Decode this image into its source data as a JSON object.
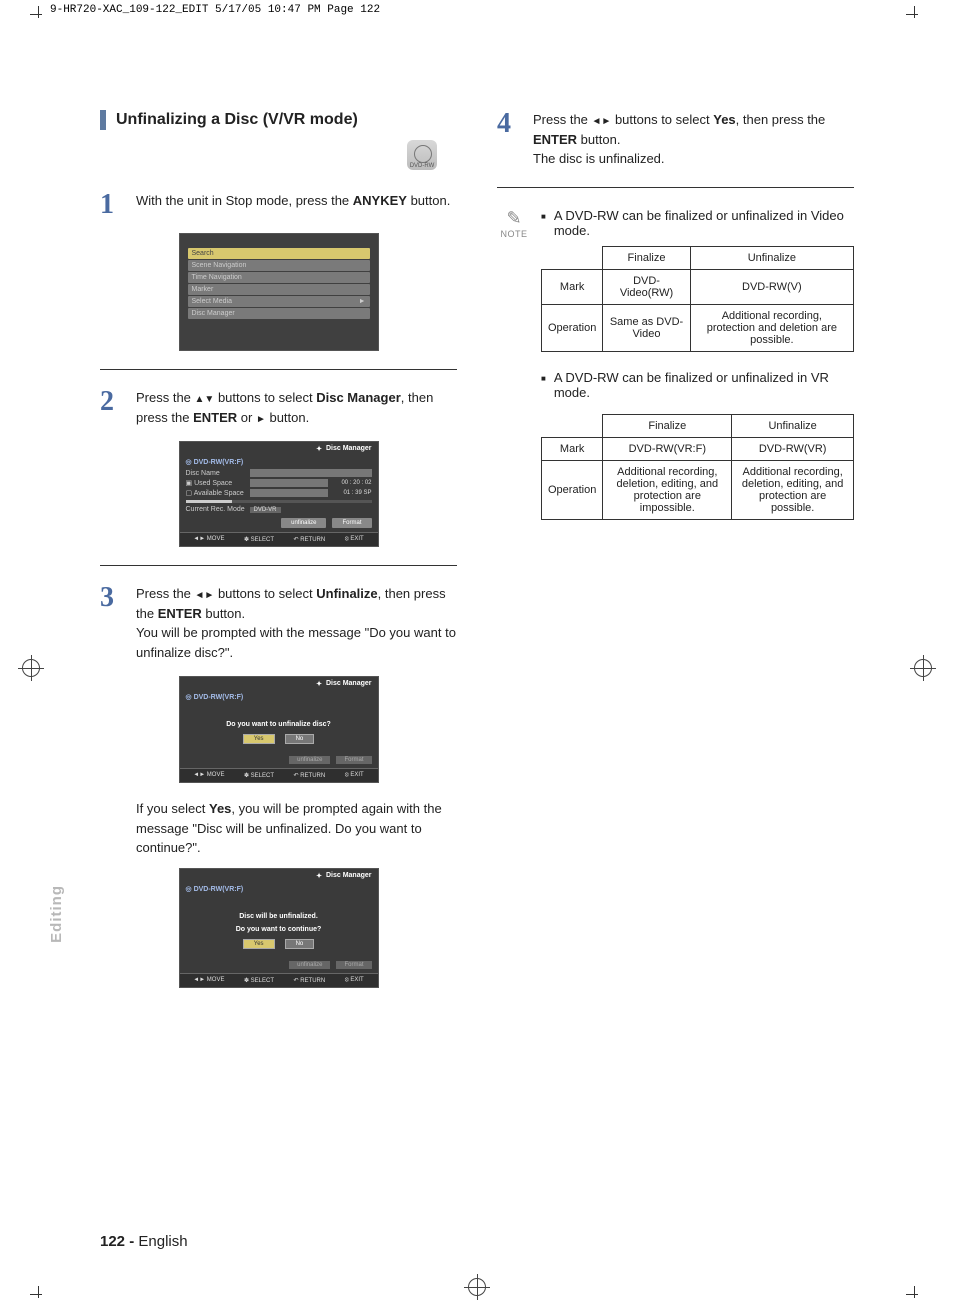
{
  "print_header": "9-HR720-XAC_109-122_EDIT  5/17/05  10:47 PM  Page 122",
  "side_tab": "Editing",
  "page_footer_num": "122 -",
  "page_footer_lang": "English",
  "section": {
    "title": "Unfinalizing a Disc (V/VR mode)",
    "disc_icon_label": "DVD-RW"
  },
  "steps": {
    "s1": {
      "num": "1",
      "text_pre": "With the unit in Stop mode, press the ",
      "bold1": "ANYKEY",
      "text_post": " button."
    },
    "s2": {
      "num": "2",
      "text_a": "Press the ",
      "text_b": " buttons to select ",
      "bold1": "Disc Manager",
      "text_c": ", then press the ",
      "bold2": "ENTER",
      "text_d": " or ",
      "text_e": " button."
    },
    "s3": {
      "num": "3",
      "text_a": "Press the ",
      "text_b": " buttons to select ",
      "bold1": "Unfinalize",
      "text_c": ", then press the ",
      "bold2": "ENTER",
      "text_d": " button.",
      "text_e": "You will be prompted with the message \"Do you want to unfinalize disc?\"."
    },
    "s3_follow": "If you select Yes, you will be prompted again with the message \"Disc will be unfinalized. Do you want to continue?\".",
    "s3_follow_bold": "Yes",
    "s4": {
      "num": "4",
      "text_a": "Press the ",
      "text_b": " buttons to select ",
      "bold1": "Yes",
      "text_c": ", then press the ",
      "bold2": "ENTER",
      "text_d": " button.",
      "text_e": "The disc is unfinalized."
    }
  },
  "osd": {
    "anykey": {
      "items": [
        "Search",
        "Scene Navigation",
        "Time Navigation",
        "Marker",
        "Select Media",
        "Disc Manager"
      ],
      "highlight_index": 0,
      "arrow_index": 4
    },
    "dm": {
      "title": "Disc Manager",
      "media": "DVD-RW(VR:F)",
      "rows": {
        "disc_name": "Disc Name",
        "used_space": "Used Space",
        "used_val": "00 : 20 : 02",
        "avail_space": "Available Space",
        "avail_val": "01 : 39 SP",
        "rec_mode": "Current Rec. Mode",
        "rec_val": "DVD-VR"
      },
      "btns": {
        "unfinalize": "unfinalize",
        "format": "Format"
      },
      "help": {
        "move": "MOVE",
        "select": "SELECT",
        "return": "RETURN",
        "exit": "EXIT"
      }
    },
    "dlg1": {
      "msg": "Do you want to unfinalize disc?",
      "yes": "Yes",
      "no": "No"
    },
    "dlg2": {
      "msg1": "Disc will be unfinalized.",
      "msg2": "Do you want to continue?",
      "yes": "Yes",
      "no": "No"
    }
  },
  "note": {
    "label": "NOTE",
    "bullet1": "A DVD-RW can be finalized or unfinalized in Video mode.",
    "bullet2": "A DVD-RW can be finalized or unfinalized in VR mode."
  },
  "table1": {
    "h_finalize": "Finalize",
    "h_unfinalize": "Unfinalize",
    "r_mark": "Mark",
    "mark_fin": "DVD-Video(RW)",
    "mark_unfin": "DVD-RW(V)",
    "r_op": "Operation",
    "op_fin": "Same as DVD-Video",
    "op_unfin": "Additional recording, protection and deletion are possible."
  },
  "table2": {
    "h_finalize": "Finalize",
    "h_unfinalize": "Unfinalize",
    "r_mark": "Mark",
    "mark_fin": "DVD-RW(VR:F)",
    "mark_unfin": "DVD-RW(VR)",
    "r_op": "Operation",
    "op_fin": "Additional recording, deletion, editing, and protection are impossible.",
    "op_unfin": "Additional recording, deletion, editing, and protection are possible."
  }
}
